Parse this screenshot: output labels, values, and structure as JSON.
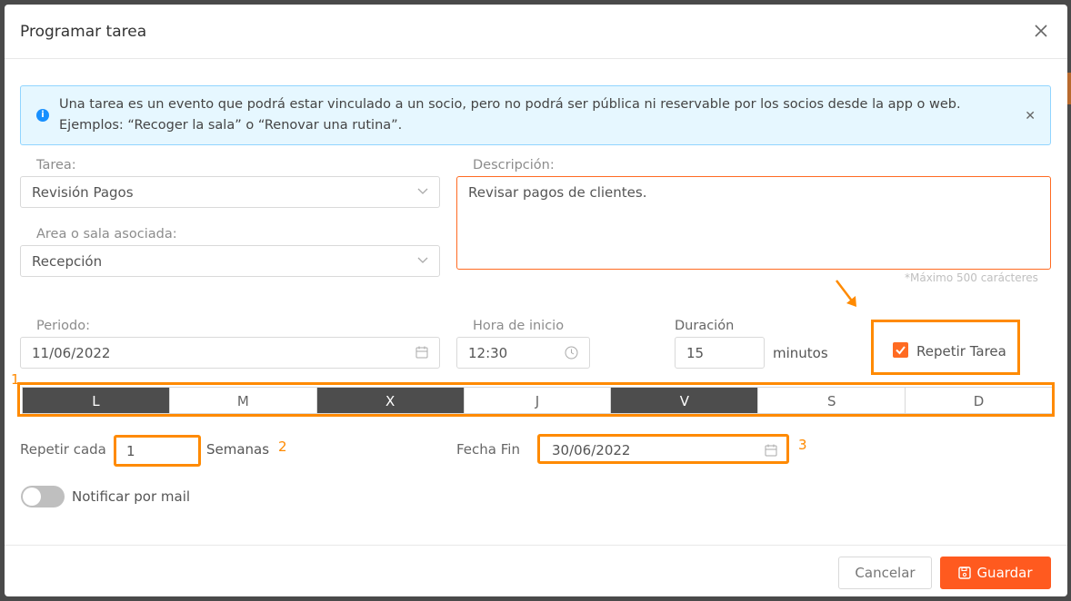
{
  "modal": {
    "title": "Programar tarea"
  },
  "info": {
    "line1": "Una tarea es un evento que podrá estar vinculado a un socio, pero no podrá ser pública ni reservable por los socios desde la app o web.",
    "line2": "Ejemplos: “Recoger la sala” o “Renovar una rutina”.",
    "icon": "info-icon"
  },
  "form": {
    "tarea_label": "Tarea:",
    "tarea_value": "Revisión Pagos",
    "area_label": "Area o sala asociada:",
    "area_value": "Recepción",
    "descripcion_label": "Descripción:",
    "descripcion_value": "Revisar pagos de clientes.",
    "descripcion_hint": "*Máximo 500 carácteres",
    "periodo_label": "Periodo:",
    "periodo_value": "11/06/2022",
    "hora_label": "Hora de inicio",
    "hora_value": "12:30",
    "duracion_label": "Duración",
    "duracion_value": "15",
    "duracion_unit": "minutos",
    "repetir_tarea_label": "Repetir Tarea",
    "repetir_tarea_checked": true,
    "days": [
      {
        "label": "L",
        "selected": true
      },
      {
        "label": "M",
        "selected": false
      },
      {
        "label": "X",
        "selected": true
      },
      {
        "label": "J",
        "selected": false
      },
      {
        "label": "V",
        "selected": true
      },
      {
        "label": "S",
        "selected": false
      },
      {
        "label": "D",
        "selected": false
      }
    ],
    "repetir_cada_label": "Repetir cada",
    "repetir_cada_value": "1",
    "repetir_cada_unit": "Semanas",
    "fecha_fin_label": "Fecha Fin",
    "fecha_fin_value": "30/06/2022",
    "notificar_label": "Notificar por mail",
    "notificar_on": false
  },
  "annotations": {
    "n1": "1",
    "n2": "2",
    "n3": "3",
    "color": "#ff8a00"
  },
  "footer": {
    "cancel_label": "Cancelar",
    "save_label": "Guardar"
  },
  "colors": {
    "accent": "#ff5a1f",
    "day_selected": "#4d4d4d",
    "info_bg": "#e6f7ff"
  }
}
